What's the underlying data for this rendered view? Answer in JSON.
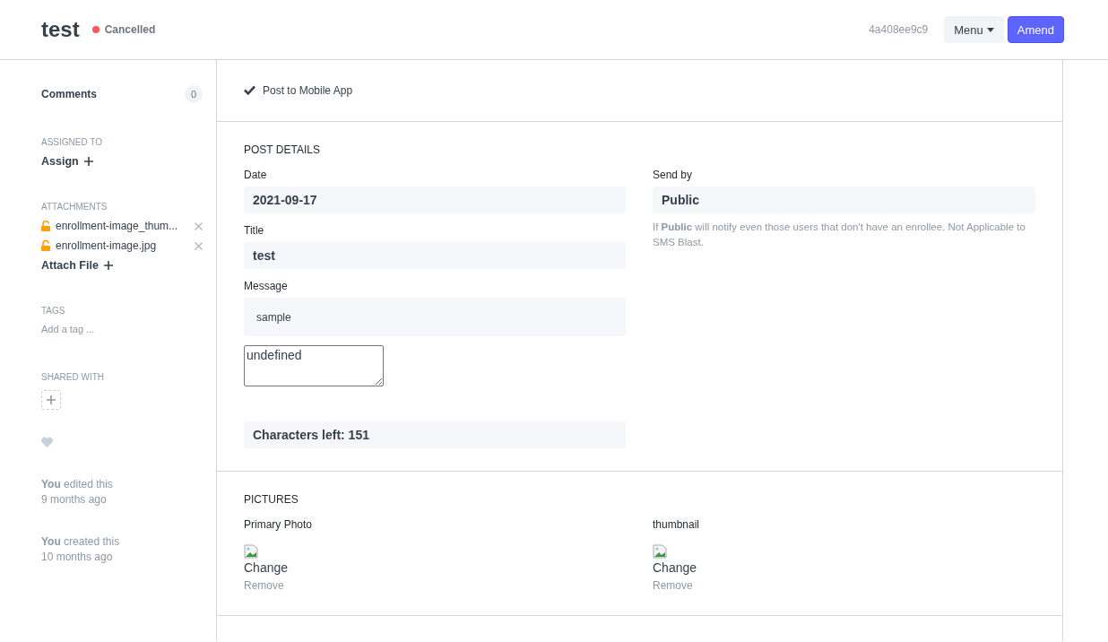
{
  "header": {
    "title": "test",
    "status": {
      "label": "Cancelled"
    },
    "doc_id": "4a408ee9c9",
    "buttons": [
      {
        "label": "Menu",
        "kind": "dropdown"
      },
      {
        "label": "Amend",
        "kind": "primary"
      }
    ]
  },
  "sidebar": {
    "comments": {
      "label": "Comments",
      "count": "0"
    },
    "assigned_to": {
      "heading": "ASSIGNED TO",
      "action": "Assign"
    },
    "attachments": {
      "heading": "ATTACHMENTS",
      "files": [
        {
          "name": "enrollment-image_thum..."
        },
        {
          "name": "enrollment-image.jpg"
        }
      ],
      "action": "Attach File"
    },
    "tags": {
      "heading": "TAGS",
      "placeholder": "Add a tag ..."
    },
    "shared_with": {
      "heading": "SHARED WITH"
    },
    "liked": false,
    "activity": [
      {
        "text": "**You** edited this",
        "time": "9 months ago"
      },
      {
        "text": "**You** created this",
        "time": "10 months ago"
      }
    ]
  },
  "post_option": {
    "label": "Post to Mobile App",
    "checked": true
  },
  "post_details": {
    "heading": "POST DETAILS",
    "left_fields": [
      {
        "label": "Date",
        "value": "2021-09-17",
        "kind": "bold"
      },
      {
        "label": "Title",
        "value": "test",
        "kind": "bold"
      },
      {
        "label": "Message",
        "value": "sample",
        "kind": "plain"
      }
    ],
    "textarea": {
      "value": "undefined"
    },
    "characters_left": "Characters left: 151",
    "send_by": {
      "label": "Send by",
      "value": "Public",
      "help": "If **Public** will notify even those users that don't have an enrollee. Not Applicable to SMS Blast."
    }
  },
  "pictures": {
    "heading": "PICTURES",
    "items": [
      {
        "label": "Primary Photo",
        "change": "Change",
        "remove": "Remove"
      },
      {
        "label": "thumbnail",
        "change": "Change",
        "remove": "Remove"
      }
    ]
  }
}
